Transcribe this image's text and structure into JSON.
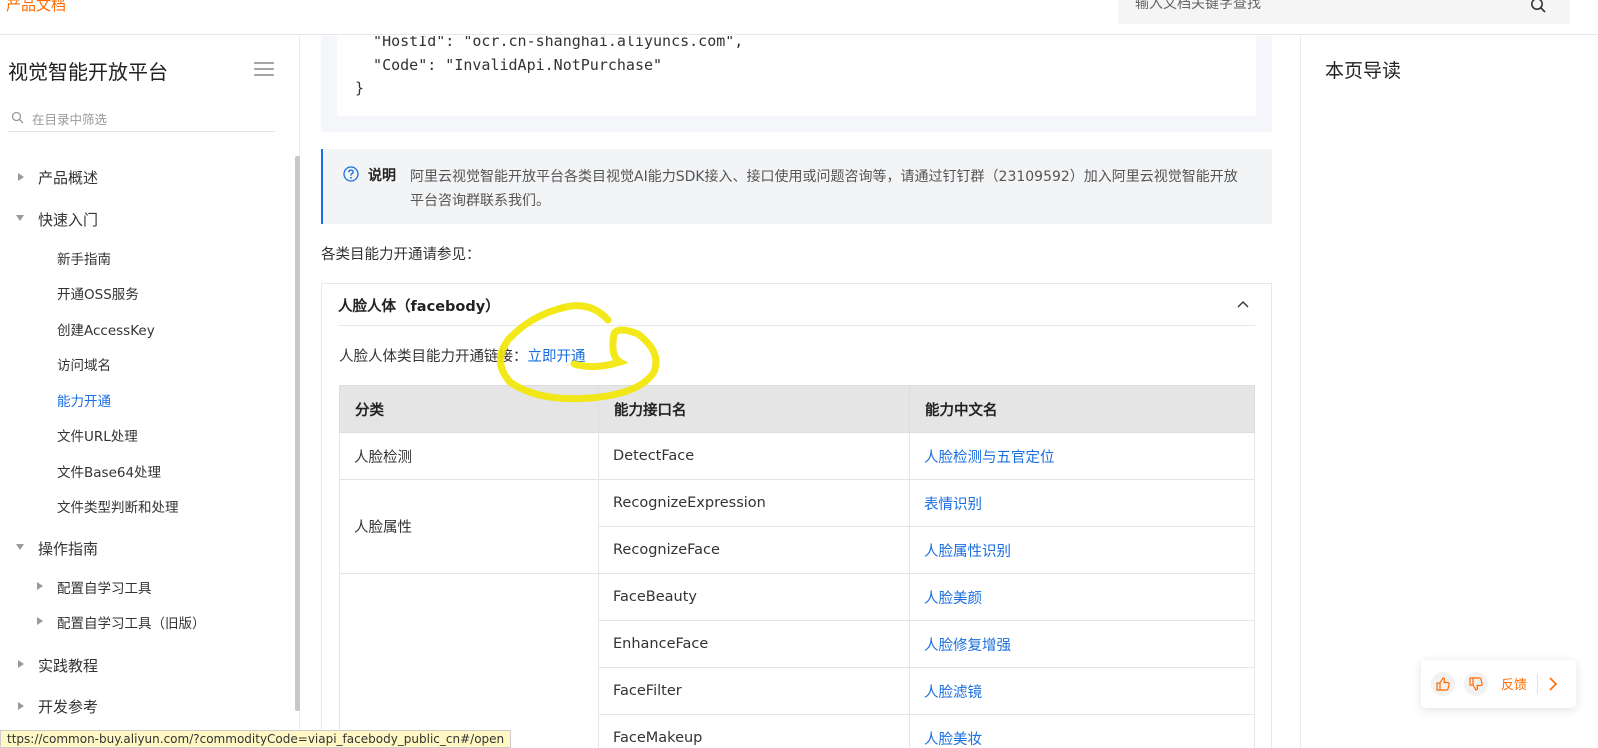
{
  "topbar": {
    "brand": "产品文档",
    "search_placeholder": "输入文档关键字查找"
  },
  "sidebar": {
    "title": "视觉智能开放平台",
    "filter_placeholder": "在目录中筛选",
    "items": [
      {
        "label": "产品概述",
        "level": 1,
        "state": "collapsed"
      },
      {
        "label": "快速入门",
        "level": 1,
        "state": "expanded"
      },
      {
        "label": "新手指南",
        "level": 2
      },
      {
        "label": "开通OSS服务",
        "level": 2
      },
      {
        "label": "创建AccessKey",
        "level": 2
      },
      {
        "label": "访问域名",
        "level": 2
      },
      {
        "label": "能力开通",
        "level": 2,
        "active": true
      },
      {
        "label": "文件URL处理",
        "level": 2
      },
      {
        "label": "文件Base64处理",
        "level": 2
      },
      {
        "label": "文件类型判断和处理",
        "level": 2
      },
      {
        "label": "操作指南",
        "level": 1,
        "state": "expanded"
      },
      {
        "label": "配置自学习工具",
        "level": 2,
        "state": "collapsed"
      },
      {
        "label": "配置自学习工具（旧版）",
        "level": 2,
        "state": "collapsed"
      },
      {
        "label": "实践教程",
        "level": 1,
        "state": "collapsed"
      },
      {
        "label": "开发参考",
        "level": 1,
        "state": "collapsed"
      }
    ]
  },
  "code": {
    "lines": [
      "  \"HostId\": \"ocr.cn-shanghai.aliyuncs.com\",",
      "  \"Code\": \"InvalidApi.NotPurchase\"",
      "}"
    ]
  },
  "note": {
    "label": "说明",
    "text": "阿里云视觉智能开放平台各类目视觉AI能力SDK接入、接口使用或问题咨询等，请通过钉钉群（23109592）加入阿里云视觉智能开放平台咨询群联系我们。"
  },
  "section_lead": "各类目能力开通请参见：",
  "panel": {
    "title": "人脸人体（facebody）",
    "open_prefix": "人脸人体类目能力开通链接：",
    "open_link": "立即开通"
  },
  "table": {
    "headers": [
      "分类",
      "能力接口名",
      "能力中文名"
    ],
    "rows": [
      {
        "category": "人脸检测",
        "api": "DetectFace",
        "name": "人脸检测与五官定位"
      },
      {
        "category": "人脸属性",
        "api": "RecognizeExpression",
        "name": "表情识别"
      },
      {
        "category": "",
        "api": "RecognizeFace",
        "name": "人脸属性识别"
      },
      {
        "category": "",
        "api": "FaceBeauty",
        "name": "人脸美颜"
      },
      {
        "category": "",
        "api": "EnhanceFace",
        "name": "人脸修复增强"
      },
      {
        "category": "",
        "api": "FaceFilter",
        "name": "人脸滤镜"
      },
      {
        "category": "",
        "api": "FaceMakeup",
        "name": "人脸美妆"
      }
    ]
  },
  "toc": {
    "title": "本页导读"
  },
  "feedback": {
    "label": "反馈"
  },
  "statusbar": {
    "url": "ttps://common-buy.aliyun.com/?commodityCode=viapi_facebody_public_cn#/open"
  },
  "colors": {
    "accent": "#1a6fe0",
    "brand": "#ff6a00",
    "highlight": "#f2e600"
  }
}
